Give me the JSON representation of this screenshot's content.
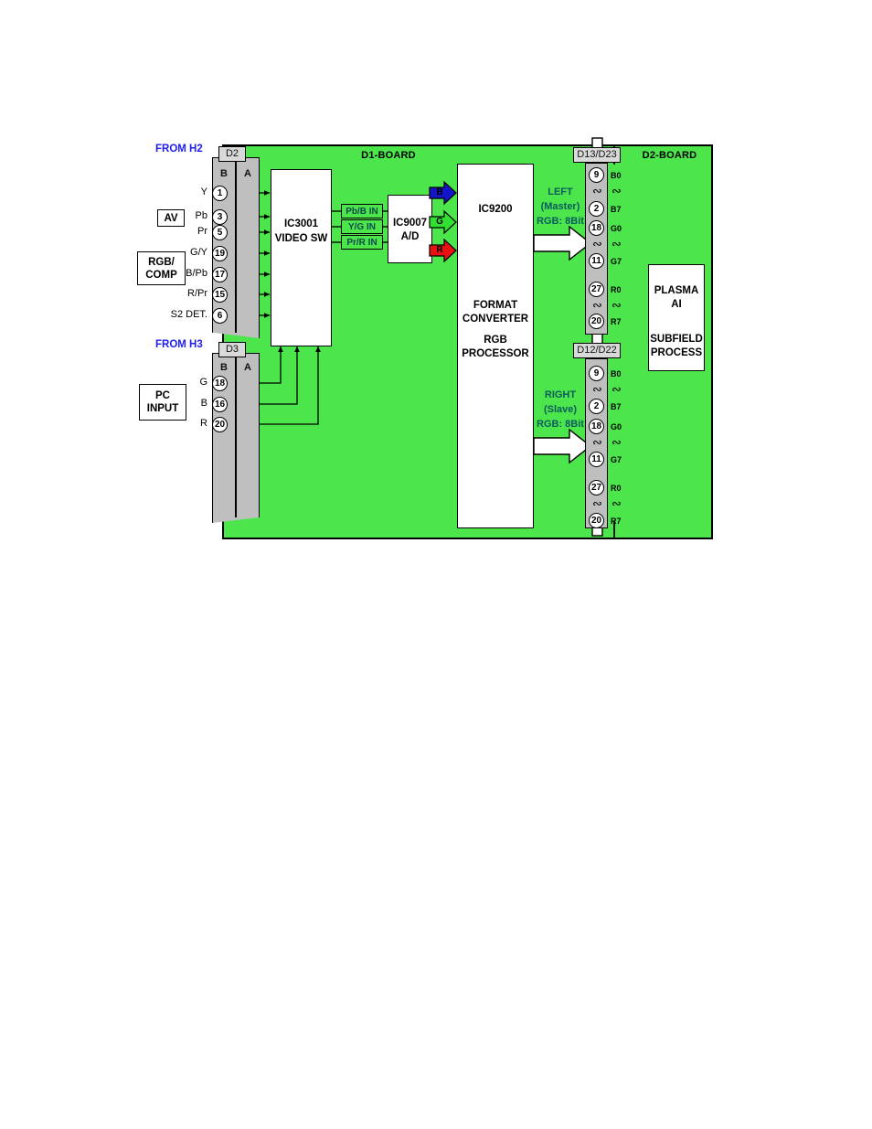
{
  "boards": {
    "d1_label": "D1-BOARD",
    "d2_label": "D2-BOARD"
  },
  "sources": {
    "from_h2": "FROM H2",
    "from_h3": "FROM H3",
    "av": "AV",
    "rgb_comp_line1": "RGB/",
    "rgb_comp_line2": "COMP",
    "pc_line1": "PC",
    "pc_line2": "INPUT"
  },
  "connector_d2": {
    "tag": "D2",
    "col_b": "B",
    "col_a": "A",
    "pins": [
      {
        "signal": "Y",
        "number": "1"
      },
      {
        "signal": "Pb",
        "number": "3"
      },
      {
        "signal": "Pr",
        "number": "5"
      },
      {
        "signal": "G/Y",
        "number": "19"
      },
      {
        "signal": "B/Pb",
        "number": "17"
      },
      {
        "signal": "R/Pr",
        "number": "15"
      },
      {
        "signal": "S2 DET.",
        "number": "6"
      }
    ]
  },
  "connector_d3": {
    "tag": "D3",
    "col_b": "B",
    "col_a": "A",
    "pins": [
      {
        "signal": "G",
        "number": "18"
      },
      {
        "signal": "B",
        "number": "16"
      },
      {
        "signal": "R",
        "number": "20"
      }
    ]
  },
  "ic3001": {
    "line1": "IC3001",
    "line2": "VIDEO SW"
  },
  "ic9007": {
    "line1": "IC9007",
    "line2": "A/D"
  },
  "ic9200": {
    "line1": "IC9200",
    "line2": "FORMAT",
    "line3": "CONVERTER",
    "line4": "RGB",
    "line5": "PROCESSOR"
  },
  "input_chips": [
    {
      "label": "Pb/B IN"
    },
    {
      "label": "Y/G IN"
    },
    {
      "label": "Pr/R IN"
    }
  ],
  "rgb_arrows": [
    {
      "label": "B",
      "color": "#1414c8"
    },
    {
      "label": "G",
      "color": "#32e032"
    },
    {
      "label": "R",
      "color": "#e81010"
    }
  ],
  "outputs": [
    {
      "side_line1": "LEFT",
      "side_line2": "(Master)",
      "side_line3": "RGB: 8Bit",
      "connector_tag": "D13/D23",
      "pins": [
        {
          "number": "9",
          "name": "B0"
        },
        {
          "number": "2",
          "name": "B7"
        },
        {
          "number": "18",
          "name": "G0"
        },
        {
          "number": "11",
          "name": "G7"
        },
        {
          "number": "27",
          "name": "R0"
        },
        {
          "number": "20",
          "name": "R7"
        }
      ]
    },
    {
      "side_line1": "RIGHT",
      "side_line2": "(Slave)",
      "side_line3": "RGB: 8Bit",
      "connector_tag": "D12/D22",
      "pins": [
        {
          "number": "9",
          "name": "B0"
        },
        {
          "number": "2",
          "name": "B7"
        },
        {
          "number": "18",
          "name": "G0"
        },
        {
          "number": "11",
          "name": "G7"
        },
        {
          "number": "27",
          "name": "R0"
        },
        {
          "number": "20",
          "name": "R7"
        }
      ]
    }
  ],
  "plasma": {
    "line1": "PLASMA",
    "line2": "AI",
    "line3": "SUBFIELD",
    "line4": "PROCESS"
  },
  "colors": {
    "board_green": "#4ce64c",
    "connector_gray": "#bfbfbf",
    "source_blue": "#2020ee",
    "teal_text": "#0b5c5c"
  }
}
